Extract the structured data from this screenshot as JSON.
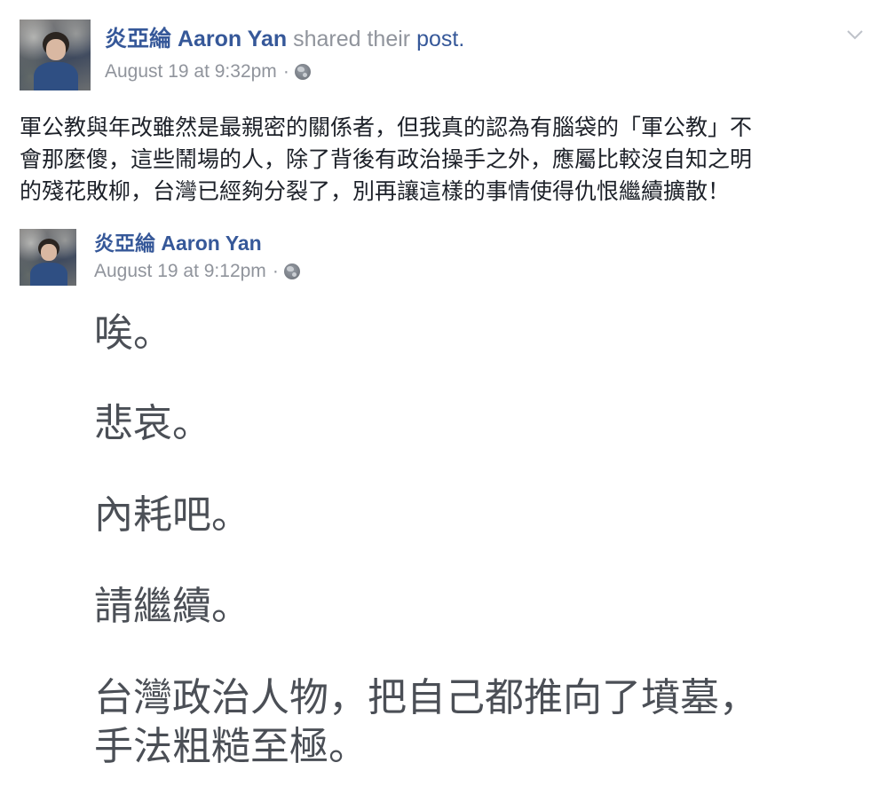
{
  "post": {
    "author": "炎亞綸 Aaron Yan",
    "shared_text": "shared their",
    "post_link": "post.",
    "timestamp": "August 19 at 9:32pm",
    "separator": "·",
    "privacy_icon": "globe-icon",
    "menu_icon": "chevron-down-icon",
    "text_lines": [
      "軍公教與年改雖然是最親密的關係者，但我真的認為有腦袋的「軍公教」不",
      "會那麼傻，這些鬧場的人，除了背後有政治操手之外，應屬比較沒自知之明",
      "的殘花敗柳，台灣已經夠分裂了，別再讓這樣的事情使得仇恨繼續擴散！"
    ]
  },
  "shared_post": {
    "author": "炎亞綸 Aaron Yan",
    "timestamp": "August 19 at 9:12pm",
    "separator": "·",
    "privacy_icon": "globe-icon",
    "lines": [
      "唉。",
      "悲哀。",
      "內耗吧。",
      "請繼續。",
      "台灣政治人物，把自己都推向了墳墓，",
      "手法粗糙至極。"
    ]
  },
  "colors": {
    "link": "#365899",
    "meta": "#90949c",
    "text": "#1d2129",
    "big_text": "#4b4f56"
  }
}
